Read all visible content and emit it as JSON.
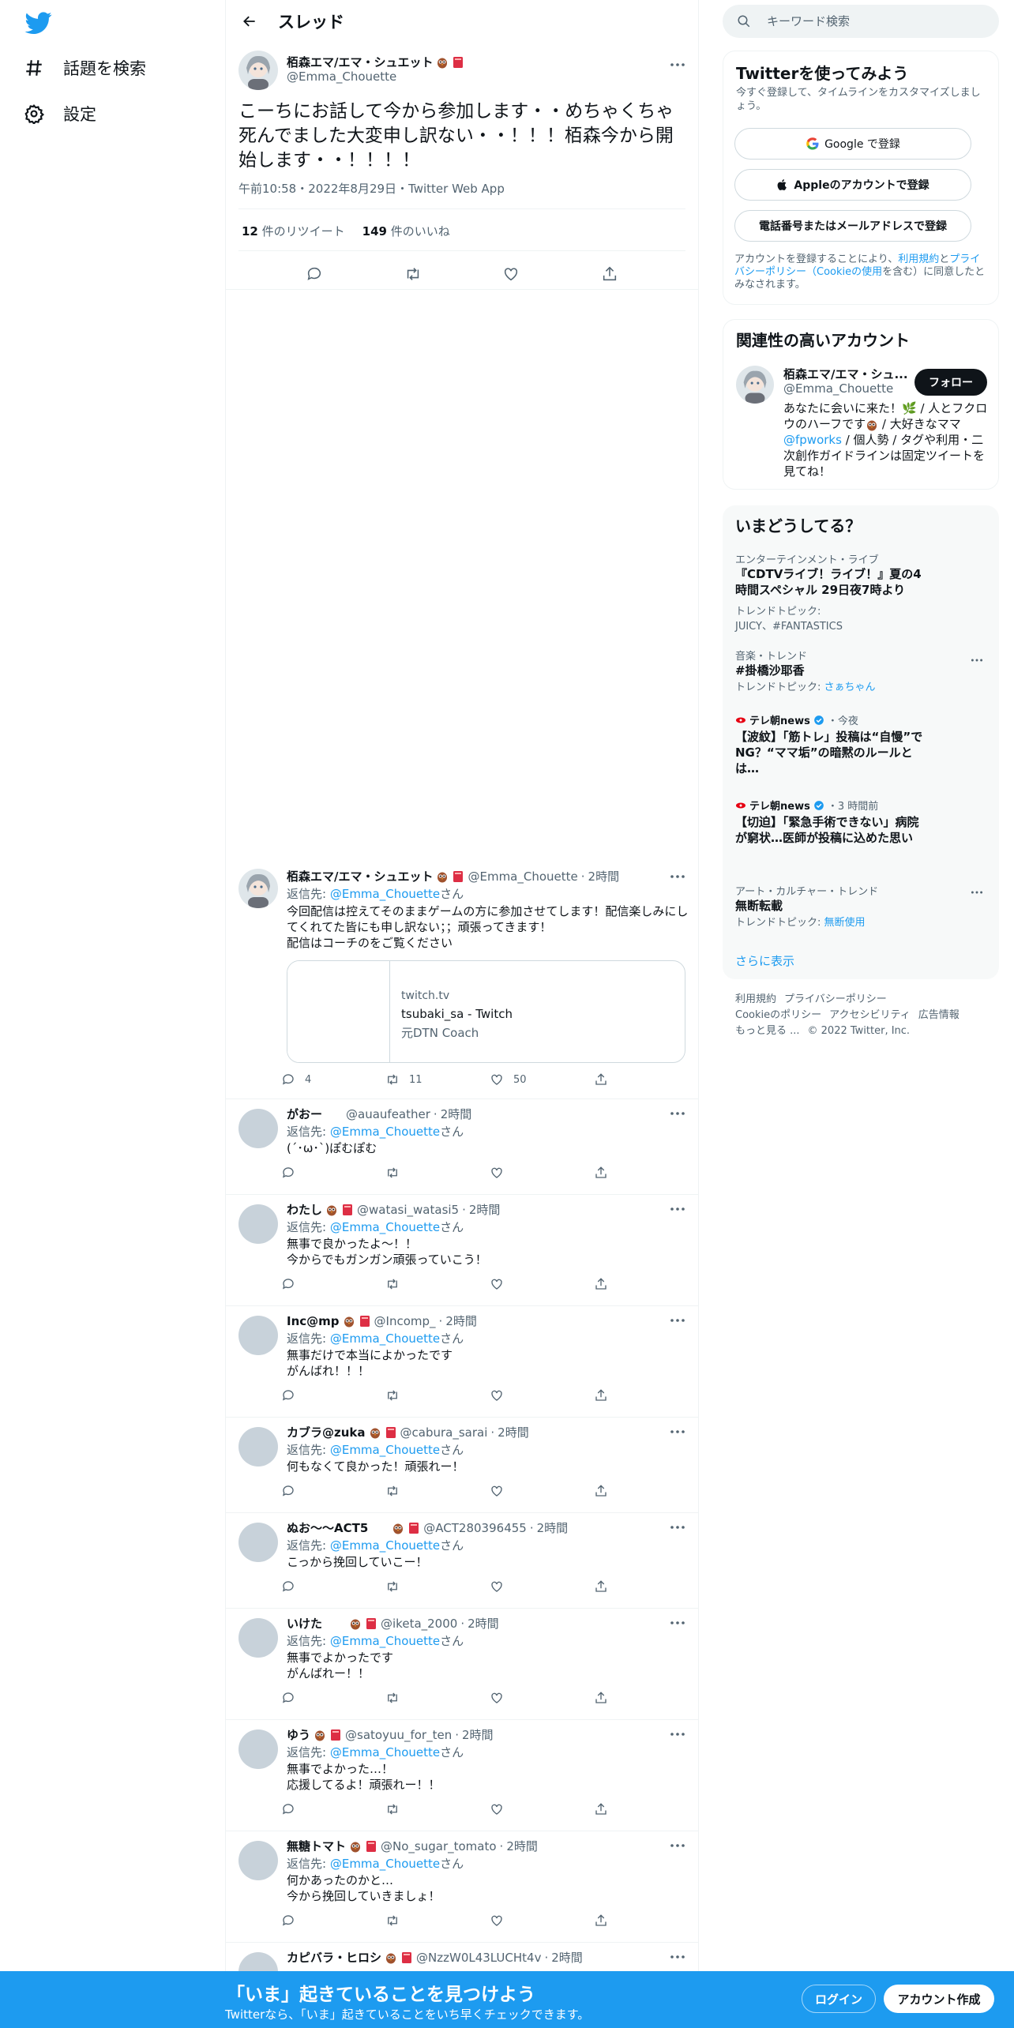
{
  "colors": {
    "accent": "#1d9bf0",
    "text": "#0f1419",
    "muted": "#536471",
    "bottom_bar": "#1d9bf0"
  },
  "nav": {
    "items": [
      {
        "label": "話題を検索",
        "icon": "hashtag-icon"
      },
      {
        "label": "設定",
        "icon": "gear-icon"
      }
    ]
  },
  "header": {
    "title": "スレッド"
  },
  "main_tweet": {
    "author_name": "栢森エマ/エマ・シュエット",
    "author_handle": "@Emma_Chouette",
    "text": "こーちにお話して今から参加します・・めちゃくちゃ死んでました大変申し訳ない・・！！！栢森今から開始します・・！！！！",
    "meta": "午前10:58・2022年8月29日・Twitter Web App",
    "retweets": "12",
    "retweets_label": "件のリツイート",
    "likes": "149",
    "likes_label": "件のいいね"
  },
  "reply_prefix": "返信先:",
  "reply_suffix": "さん",
  "replies": [
    {
      "name": "栢森エマ/エマ・シュエット",
      "handle": "@Emma_Chouette",
      "time": "2時間",
      "reply_to": "@Emma_Chouette",
      "lines": [
        "今回配信は控えてそのままゲームの方に参加させてします！配信楽しみにしてくれてた皆にも申し訳ない；；頑張ってきます！",
        "配信はコーチのをご覧ください"
      ],
      "card": {
        "domain": "twitch.tv",
        "title": "tsubaki_sa - Twitch",
        "desc": "元DTN Coach"
      },
      "counts": {
        "replies": "4",
        "retweets": "11",
        "likes": "50"
      }
    },
    {
      "name": "がおー",
      "handle": "@auaufeather",
      "time": "2時間",
      "reply_to": "@Emma_Chouette",
      "lines": [
        "(´･ω･`)ぽむぽむ"
      ]
    },
    {
      "name": "わたし",
      "handle": "@watasi_watasi5",
      "time": "2時間",
      "reply_to": "@Emma_Chouette",
      "lines": [
        "無事で良かったよ～！！",
        "今からでもガンガン頑張っていこう！"
      ]
    },
    {
      "name": "Inc@mp",
      "handle": "@Incomp_",
      "time": "2時間",
      "reply_to": "@Emma_Chouette",
      "lines": [
        "無事だけで本当によかったです",
        "がんばれ！！！"
      ]
    },
    {
      "name": "カブラ@zuka",
      "handle": "@cabura_sarai",
      "time": "2時間",
      "reply_to": "@Emma_Chouette",
      "lines": [
        "何もなくて良かった！頑張れー！"
      ]
    },
    {
      "name": "ぬお〜〜ACT5",
      "handle": "@ACT280396455",
      "time": "2時間",
      "reply_to": "@Emma_Chouette",
      "lines": [
        "こっから挽回していこー！"
      ]
    },
    {
      "name": "いけた",
      "handle": "@iketa_2000",
      "time": "2時間",
      "reply_to": "@Emma_Chouette",
      "lines": [
        "無事でよかったです",
        "がんばれー！！"
      ]
    },
    {
      "name": "ゆう",
      "handle": "@satoyuu_for_ten",
      "time": "2時間",
      "reply_to": "@Emma_Chouette",
      "lines": [
        "無事でよかった…！",
        "応援してるよ！頑張れー！！"
      ]
    },
    {
      "name": "無糖トマト",
      "handle": "@No_sugar_tomato",
      "time": "2時間",
      "reply_to": "@Emma_Chouette",
      "lines": [
        "何かあったのかと…",
        "今から挽回していきましょ！"
      ]
    },
    {
      "name": "カピバラ・ヒロシ",
      "handle": "@NzzW0L43LUCHt4v",
      "time": "2時間",
      "reply_to": "",
      "lines": []
    }
  ],
  "search": {
    "placeholder": "キーワード検索"
  },
  "signup": {
    "title": "Twitterを使ってみよう",
    "subtitle": "今すぐ登録して、タイムラインをカスタマイズしましょう。",
    "google_label": "Google で登録",
    "apple_label": "Appleのアカウントで登録",
    "phone_label": "電話番号またはメールアドレスで登録",
    "legal_1": "アカウントを登録することにより、",
    "legal_terms": "利用規約",
    "legal_2": "と",
    "legal_privacy": "プライバシーポリシー（Cookieの使用",
    "legal_3": "を含む）に同意したとみなされます。"
  },
  "related": {
    "title": "関連性の高いアカウント",
    "name": "栢森エマ/エマ・シュ...",
    "handle": "@Emma_Chouette",
    "follow_label": "フォロー",
    "bio_1": "あなたに会いに来た！🌿 / 人とフクロウのハーフです",
    "bio_2": " / 大好きなママ",
    "bio_mention": "@fpworks",
    "bio_3": " / 個人勢 / タグや利用・二次創作ガイドラインは固定ツイートを見てね！"
  },
  "trends": {
    "title": "いまどうしてる？",
    "items": [
      {
        "category": "エンターテインメント・ライブ",
        "title": "『CDTVライブ！ライブ！』夏の4時間スペシャル 29日夜7時より",
        "sub_label": "トレンドトピック:",
        "sub_links": "JUICY、#FANTASTICS"
      },
      {
        "category": "音楽・トレンド",
        "title": "#掛橋沙耶香",
        "sub_label": "トレンドトピック:",
        "sub_links": "さぁちゃん"
      },
      {
        "source": "テレ朝news",
        "time": "・今夜",
        "title": "【波紋】「筋トレ」投稿は“自慢”でNG？“ママ垢”の暗黙のルールとは…"
      },
      {
        "source": "テレ朝news",
        "time": "・3 時間前",
        "title": "【切迫】「緊急手術できない」病院が窮状…医師が投稿に込めた思い"
      },
      {
        "category": "アート・カルチャー・トレンド",
        "title": "無断転載",
        "sub_label": "トレンドトピック:",
        "sub_links": "無断使用"
      }
    ],
    "show_more": "さらに表示"
  },
  "footer": {
    "terms": "利用規約",
    "privacy": "プライバシーポリシー",
    "cookie": "Cookieのポリシー",
    "accessibility": "アクセシビリティ",
    "ads": "広告情報",
    "more": "もっと見る ...",
    "copyright": "© 2022 Twitter, Inc."
  },
  "bottom_bar": {
    "title": "「いま」起きていることを見つけよう",
    "subtitle": "Twitterなら、「いま」起きていることをいち早くチェックできます。",
    "login_label": "ログイン",
    "signup_label": "アカウント作成"
  }
}
